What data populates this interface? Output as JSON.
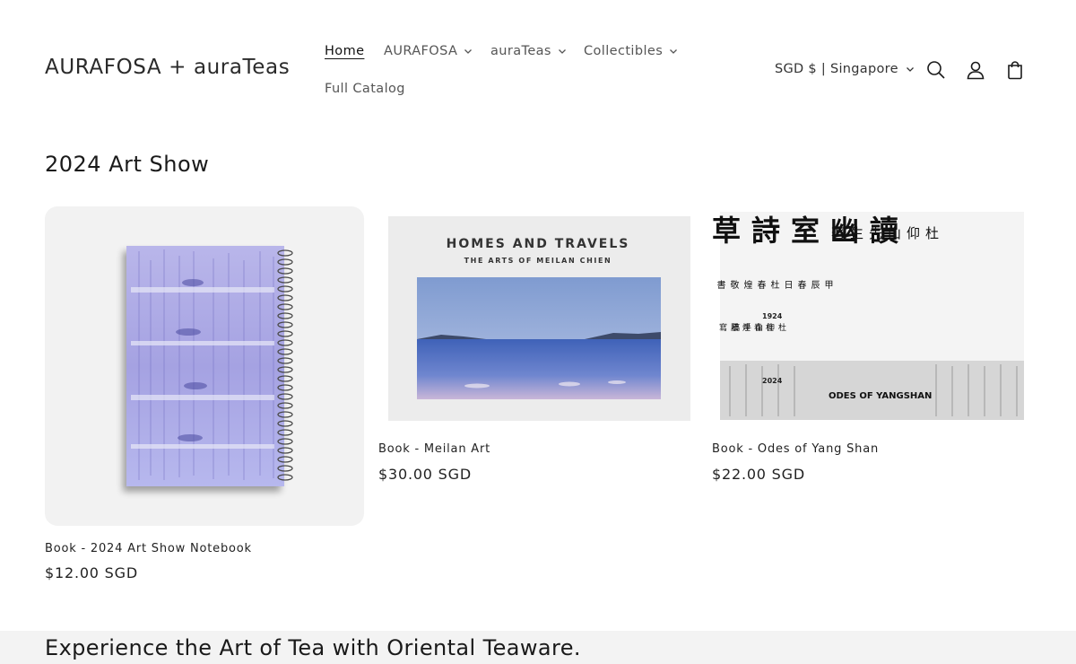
{
  "header": {
    "logo": "AURAFOSA + auraTeas",
    "nav": [
      {
        "label": "Home",
        "dropdown": false,
        "active": true
      },
      {
        "label": "AURAFOSA",
        "dropdown": true,
        "active": false
      },
      {
        "label": "auraTeas",
        "dropdown": true,
        "active": false
      },
      {
        "label": "Collectibles",
        "dropdown": true,
        "active": false
      },
      {
        "label": "Full Catalog",
        "dropdown": false,
        "active": false
      }
    ],
    "currency": "SGD $ | Singapore",
    "icons": [
      "search-icon",
      "account-icon",
      "cart-icon"
    ]
  },
  "section": {
    "title": "2024 Art Show"
  },
  "products": [
    {
      "title": "Book - 2024 Art Show Notebook",
      "price": "$12.00 SGD"
    },
    {
      "title": "Book - Meilan Art",
      "price": "$30.00 SGD",
      "cover_title": "HOMES AND TRAVELS",
      "cover_subtitle": "THE ARTS OF MEILAN CHIEN"
    },
    {
      "title": "Book - Odes of Yang Shan",
      "price": "$22.00 SGD",
      "cover_title": "ODES OF YANGSHAN",
      "cover_years": [
        "1924",
        "2024"
      ],
      "cover_chinese_main": "讀幽室詩草",
      "cover_chinese_side_right": "杜仰山先生著",
      "cover_chinese_side_left": "甲辰春日杜春煌敬書",
      "cover_chinese_small_a": "杜仰山手稿",
      "cover_chinese_small_b": "杜春煌謄寫"
    }
  ],
  "banner": {
    "text": "Experience the Art of Tea with Oriental Teaware."
  },
  "colors": {
    "text": "#121212",
    "muted": "#555555",
    "card_bg": "#f2f2f2",
    "banner_bg": "#f3f3f3"
  }
}
